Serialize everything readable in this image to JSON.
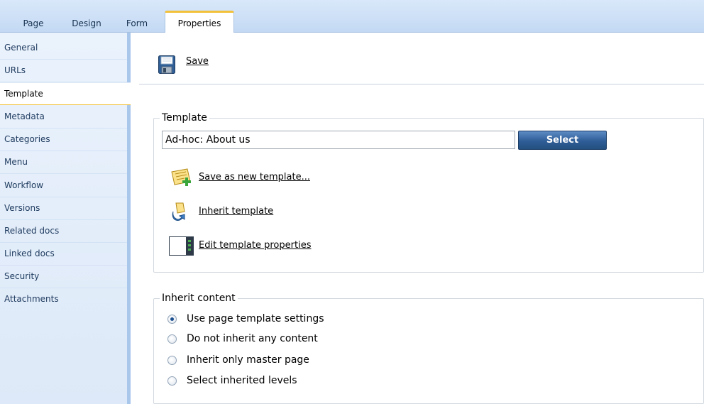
{
  "tabs": [
    {
      "label": "Page",
      "active": false
    },
    {
      "label": "Design",
      "active": false
    },
    {
      "label": "Form",
      "active": false
    },
    {
      "label": "Properties",
      "active": true
    }
  ],
  "sidebar": {
    "items": [
      {
        "label": "General"
      },
      {
        "label": "URLs"
      },
      {
        "label": "Template",
        "selected": true
      },
      {
        "label": "Metadata"
      },
      {
        "label": "Categories"
      },
      {
        "label": "Menu"
      },
      {
        "label": "Workflow"
      },
      {
        "label": "Versions"
      },
      {
        "label": "Related docs"
      },
      {
        "label": "Linked docs"
      },
      {
        "label": "Security"
      },
      {
        "label": "Attachments"
      }
    ]
  },
  "toolbar": {
    "save_label": "Save",
    "save_icon": "floppy-disk-icon"
  },
  "template_group": {
    "legend": "Template",
    "input_value": "Ad-hoc: About us",
    "select_label": "Select",
    "actions": [
      {
        "label": "Save as new template...",
        "icon": "save-template-icon"
      },
      {
        "label": "Inherit template",
        "icon": "inherit-template-icon"
      },
      {
        "label": "Edit template properties",
        "icon": "edit-template-icon"
      }
    ]
  },
  "inherit_group": {
    "legend": "Inherit content",
    "options": [
      {
        "label": "Use page template settings",
        "checked": true
      },
      {
        "label": "Do not inherit any content",
        "checked": false
      },
      {
        "label": "Inherit only master page",
        "checked": false
      },
      {
        "label": "Select inherited levels",
        "checked": false
      }
    ]
  },
  "colors": {
    "accent": "#f3c13a",
    "sidebar_bg": "#e4eefa",
    "select_button": "#2e5d97"
  }
}
